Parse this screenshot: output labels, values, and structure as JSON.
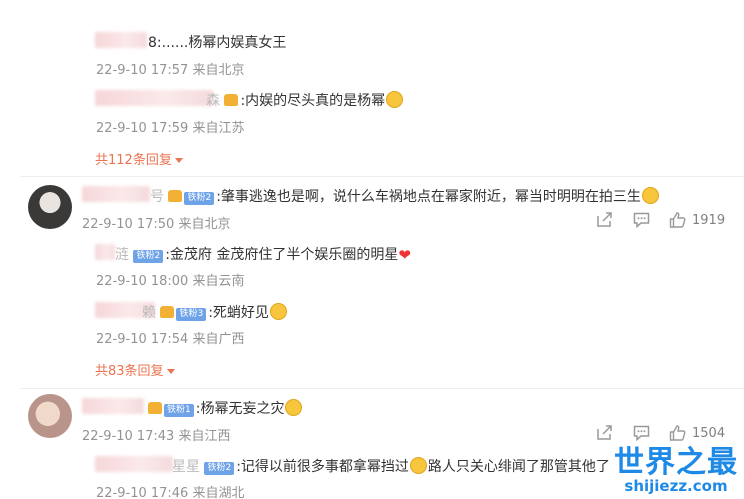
{
  "replies_top": [
    {
      "name": "8",
      "text": ":......杨幂内娱真女王",
      "meta": "22-9-10 17:57 来自北京"
    },
    {
      "name": "森",
      "text": ":内娱的尽头真的是杨幂",
      "meta": "22-9-10 17:59 来自江苏"
    }
  ],
  "more_top": "共112条回复",
  "comment1": {
    "name": "号",
    "badge": "铁粉2",
    "text": ":肇事逃逸也是啊，说什么车祸地点在幂家附近，幂当时明明在拍三生",
    "meta": "22-9-10 17:50 来自北京",
    "likes": "1919",
    "replies": [
      {
        "name": "涟",
        "badge": "铁粉2",
        "text": ":金茂府 金茂府住了半个娱乐圈的明星",
        "meta": "22-9-10 18:00 来自云南"
      },
      {
        "name": "赖",
        "badge": "铁粉3",
        "text": ":死蛸好见",
        "meta": "22-9-10 17:54 来自广西"
      }
    ],
    "more": "共83条回复"
  },
  "comment2": {
    "name": "",
    "badge": "铁粉1",
    "text": ":杨幂无妄之灾",
    "meta": "22-9-10 17:43 来自江西",
    "likes": "1504",
    "replies": [
      {
        "name": "星星",
        "badge": "铁粉2",
        "text": ":记得以前很多事都拿幂挡过",
        "text2": "路人只关心绯闻了那管其他了",
        "meta": "22-9-10 17:46 来自湖北"
      }
    ]
  },
  "watermark": {
    "big": "世界之最",
    "small": "shijiezz.com"
  },
  "icons": {
    "share": "share-icon",
    "comment": "comment-icon",
    "like": "like-icon"
  },
  "colors": {
    "link": "#eb7350",
    "meta": "#939393",
    "watermark": "#1e8ae6"
  }
}
